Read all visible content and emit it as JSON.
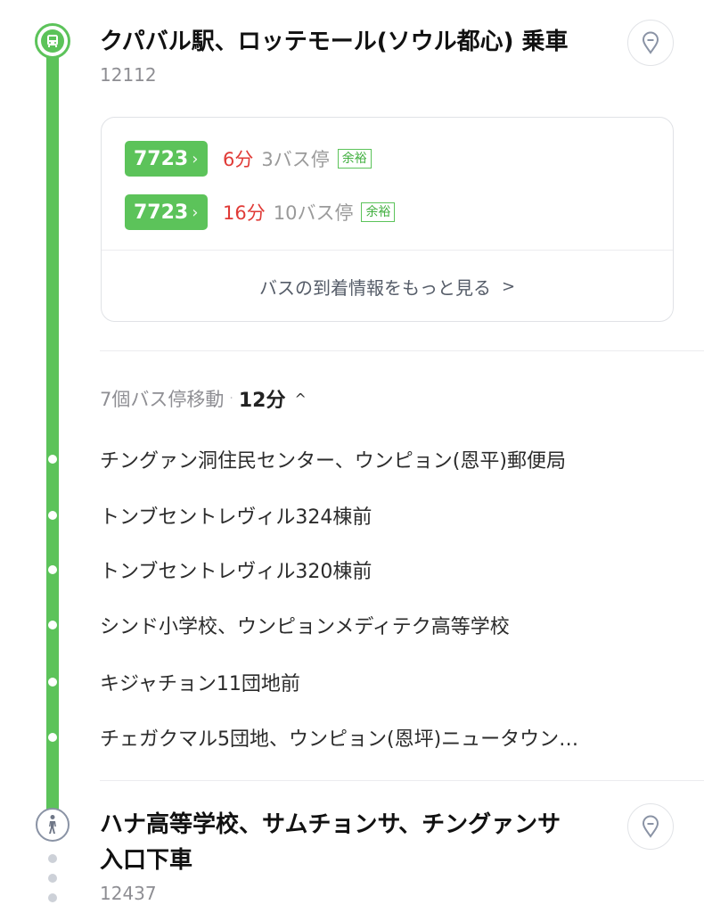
{
  "boarding": {
    "station_name": "クパバル駅、ロッテモール(ソウル都心) 乗車",
    "station_id": "12112",
    "icon": "bus-icon",
    "pin_icon": "map-pin-icon"
  },
  "arrivals": [
    {
      "bus_number": "7723",
      "minutes": "6分",
      "stops": "3バス停",
      "crowding": "余裕"
    },
    {
      "bus_number": "7723",
      "minutes": "16分",
      "stops": "10バス停",
      "crowding": "余裕"
    }
  ],
  "more_arrivals_label": "バスの到着情報をもっと見る",
  "move_summary": {
    "label": "7個バス停移動",
    "separator": "·",
    "duration": "12分",
    "toggle": "^"
  },
  "intermediate_stops": [
    "チングァン洞住民センター、ウンピョン(恩平)郵便局",
    "トンブセントレヴィル324棟前",
    "トンブセントレヴィル320棟前",
    "シンド小学校、ウンピョンメディテク高等学校",
    "キジャチョン11団地前",
    "チェガクマル5団地、ウンピョン(恩坪)ニュータウン…"
  ],
  "alighting": {
    "station_name_line1": "ハナ高等学校、サムチョンサ、チングァンサ",
    "station_name_line2": "入口下車",
    "station_id": "12437",
    "icon": "walking-person-icon",
    "pin_icon": "map-pin-icon"
  },
  "colors": {
    "route_green": "#5cc35a",
    "arrival_red": "#e03a36",
    "muted_gray": "#8e8e93"
  }
}
